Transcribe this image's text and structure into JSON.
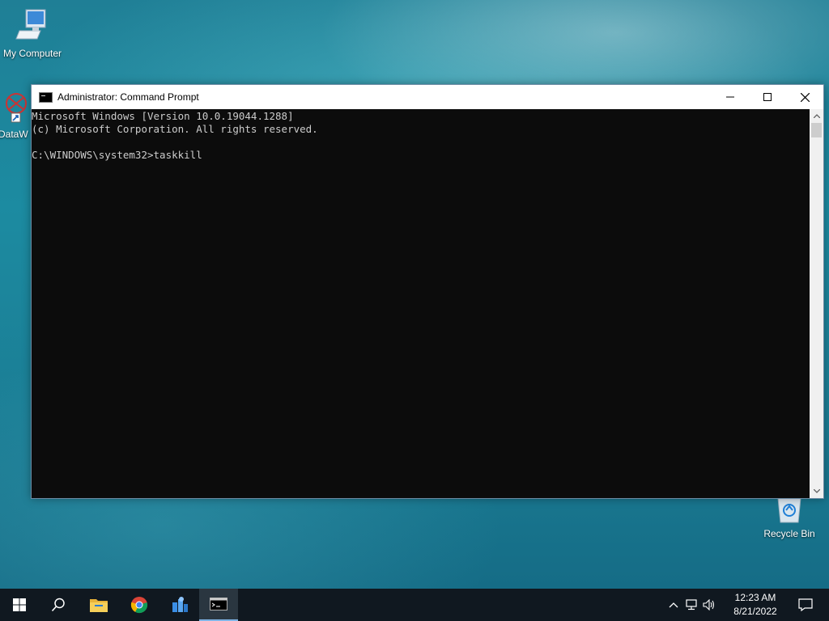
{
  "desktop": {
    "icons": [
      {
        "label": "My Computer",
        "icon": "computer-icon"
      },
      {
        "label": "DataW",
        "icon": "datawrapper-shortcut-icon"
      },
      {
        "label": "Recycle Bin",
        "icon": "recycle-bin-icon"
      }
    ]
  },
  "window": {
    "title": "Administrator: Command Prompt",
    "console_lines": [
      "Microsoft Windows [Version 10.0.19044.1288]",
      "(c) Microsoft Corporation. All rights reserved.",
      "",
      "C:\\WINDOWS\\system32>taskkill"
    ]
  },
  "taskbar": {
    "buttons": [
      {
        "icon": "windows-start-icon"
      },
      {
        "icon": "search-icon"
      },
      {
        "icon": "file-explorer-icon"
      },
      {
        "icon": "chrome-icon"
      },
      {
        "icon": "app-icon"
      },
      {
        "icon": "command-prompt-icon",
        "active": true
      }
    ],
    "clock": {
      "time": "12:23 AM",
      "date": "8/21/2022"
    }
  },
  "colors": {
    "taskbar": "#101820",
    "console_bg": "#0c0c0c",
    "console_text": "#cccccc"
  }
}
